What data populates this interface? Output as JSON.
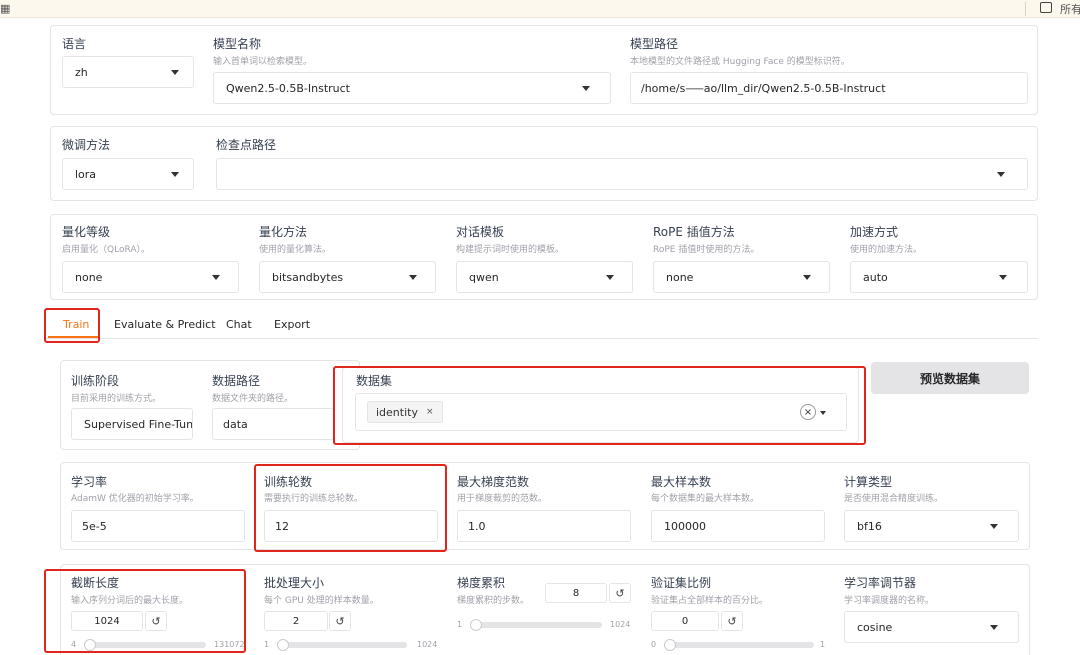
{
  "topbar": {
    "grid_icon": "▦",
    "right_text": "所有"
  },
  "model_panel": {
    "lang_label": "语言",
    "lang_value": "zh",
    "model_name_label": "模型名称",
    "model_name_info": "输入首单词以检索模型。",
    "model_name_value": "Qwen2.5-0.5B-Instruct",
    "model_path_label": "模型路径",
    "model_path_info": "本地模型的文件路径或 Hugging Face 的模型标识符。",
    "model_path_value": "/home/s⸺ao/llm_dir/Qwen2.5-0.5B-Instruct"
  },
  "finetune_panel": {
    "method_label": "微调方法",
    "method_value": "lora",
    "checkpoint_label": "检查点路径",
    "checkpoint_value": ""
  },
  "quant_panel": {
    "quant_bit_label": "量化等级",
    "quant_bit_info": "启用量化（QLoRA）。",
    "quant_bit_value": "none",
    "quant_method_label": "量化方法",
    "quant_method_info": "使用的量化算法。",
    "quant_method_value": "bitsandbytes",
    "template_label": "对话模板",
    "template_info": "构建提示词时使用的模板。",
    "template_value": "qwen",
    "rope_label": "RoPE 插值方法",
    "rope_info": "RoPE 插值时使用的方法。",
    "rope_value": "none",
    "booster_label": "加速方式",
    "booster_info": "使用的加速方法。",
    "booster_value": "auto"
  },
  "tabs": [
    "Train",
    "Evaluate & Predict",
    "Chat",
    "Export"
  ],
  "train": {
    "stage_label": "训练阶段",
    "stage_info": "目前采用的训练方式。",
    "stage_value": "Supervised Fine-Tuning",
    "data_dir_label": "数据路径",
    "data_dir_info": "数据文件夹的路径。",
    "data_dir_value": "data",
    "dataset_label": "数据集",
    "dataset_chip": "identity",
    "chip_x": "×",
    "clear_x": "×",
    "preview_button": "预览数据集"
  },
  "hparams": {
    "lr_label": "学习率",
    "lr_info": "AdamW 优化器的初始学习率。",
    "lr_value": "5e-5",
    "epochs_label": "训练轮数",
    "epochs_info": "需要执行的训练总轮数。",
    "epochs_value": "12",
    "grad_norm_label": "最大梯度范数",
    "grad_norm_info": "用于梯度裁剪的范数。",
    "grad_norm_value": "1.0",
    "max_samples_label": "最大样本数",
    "max_samples_info": "每个数据集的最大样本数。",
    "max_samples_value": "100000",
    "compute_type_label": "计算类型",
    "compute_type_info": "是否使用混合精度训练。",
    "compute_type_value": "bf16"
  },
  "sliders": {
    "cutoff_label": "截断长度",
    "cutoff_info": "输入序列分词后的最大长度。",
    "cutoff_value": "1024",
    "cutoff_min": "4",
    "cutoff_max": "131072",
    "batch_label": "批处理大小",
    "batch_info": "每个 GPU 处理的样本数量。",
    "batch_value": "2",
    "batch_min": "1",
    "batch_max": "1024",
    "accum_label": "梯度累积",
    "accum_info": "梯度累积的步数。",
    "accum_value": "8",
    "accum_min": "1",
    "accum_max": "1024",
    "val_label": "验证集比例",
    "val_info": "验证集占全部样本的百分比。",
    "val_value": "0",
    "val_min": "0",
    "val_max": "1",
    "scheduler_label": "学习率调节器",
    "scheduler_info": "学习率调度器的名称。",
    "scheduler_value": "cosine",
    "reset_glyph": "↺"
  }
}
